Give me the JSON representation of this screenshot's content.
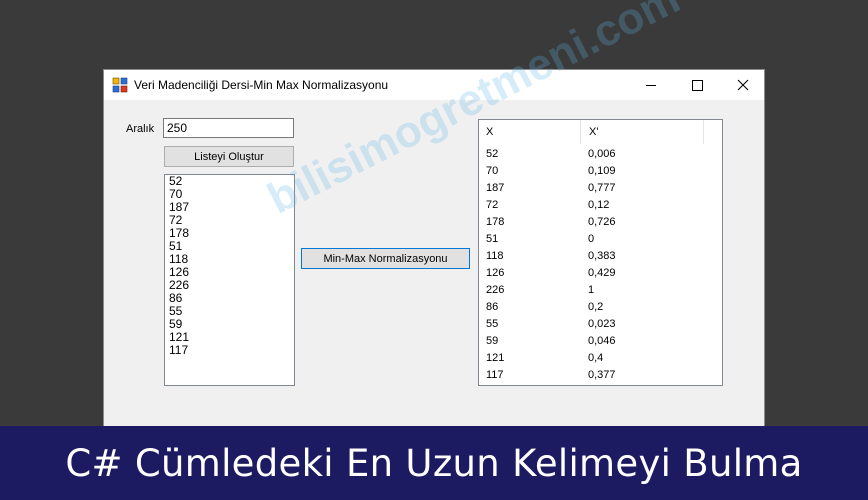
{
  "window": {
    "title": "Veri Madenciliği Dersi-Min Max Normalizasyonu",
    "icon": "winforms-app-icon"
  },
  "form": {
    "range_label": "Aralık",
    "range_value": "250",
    "generate_button": "Listeyi Oluştur",
    "normalize_button": "Min-Max Normalizasyonu",
    "list_items": [
      "52",
      "70",
      "187",
      "72",
      "178",
      "51",
      "118",
      "126",
      "226",
      "86",
      "55",
      "59",
      "121",
      "117"
    ]
  },
  "results": {
    "columns": [
      "X",
      "X'"
    ],
    "rows": [
      [
        "52",
        "0,006"
      ],
      [
        "70",
        "0,109"
      ],
      [
        "187",
        "0,777"
      ],
      [
        "72",
        "0,12"
      ],
      [
        "178",
        "0,726"
      ],
      [
        "51",
        "0"
      ],
      [
        "118",
        "0,383"
      ],
      [
        "126",
        "0,429"
      ],
      [
        "226",
        "1"
      ],
      [
        "86",
        "0,2"
      ],
      [
        "55",
        "0,023"
      ],
      [
        "59",
        "0,046"
      ],
      [
        "121",
        "0,4"
      ],
      [
        "117",
        "0,377"
      ]
    ]
  },
  "watermark": "bilisimogretmeni.com",
  "banner": {
    "text": "C# Cümledeki En Uzun Kelimeyi Bulma",
    "background": "#1c1a61"
  }
}
